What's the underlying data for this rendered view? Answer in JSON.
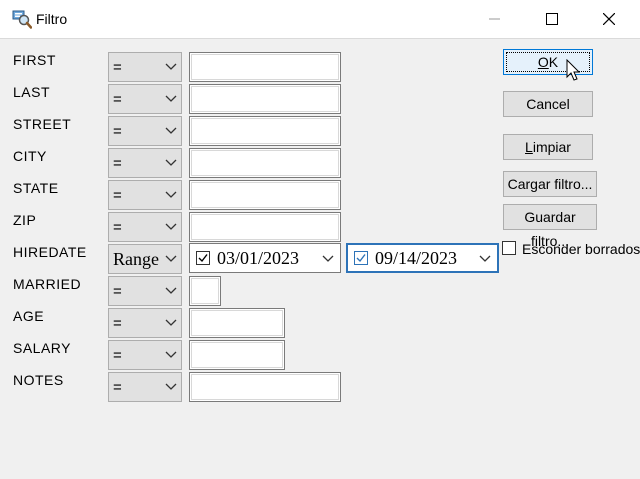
{
  "window": {
    "title": "Filtro",
    "icon": "filter-search-icon",
    "controls": [
      "minimize-icon",
      "maximize-icon",
      "close-icon"
    ]
  },
  "fields": [
    {
      "label": "FIRST",
      "operator": "=",
      "value": ""
    },
    {
      "label": "LAST",
      "operator": "=",
      "value": ""
    },
    {
      "label": "STREET",
      "operator": "=",
      "value": ""
    },
    {
      "label": "CITY",
      "operator": "=",
      "value": ""
    },
    {
      "label": "STATE",
      "operator": "=",
      "value": ""
    },
    {
      "label": "ZIP",
      "operator": "=",
      "value": ""
    },
    {
      "label": "HIREDATE",
      "operator": "Range",
      "from": "03/01/2023",
      "to": "09/14/2023",
      "from_checked": true,
      "to_checked": true
    },
    {
      "label": "MARRIED",
      "operator": "=",
      "value": ""
    },
    {
      "label": "AGE",
      "operator": "=",
      "value": ""
    },
    {
      "label": "SALARY",
      "operator": "=",
      "value": ""
    },
    {
      "label": "NOTES",
      "operator": "=",
      "value": ""
    }
  ],
  "buttons": {
    "ok_hot": "O",
    "ok_rest": "K",
    "cancel": "Cancel",
    "clear_hot": "L",
    "clear_rest": "impiar",
    "load": "Cargar filtro...",
    "save": "Guardar filtro..."
  },
  "hide_deleted": {
    "label": "Esconder borrados",
    "checked": false
  },
  "colors": {
    "accent": "#0078d7",
    "focus_border": "#2d73b8",
    "dialog_bg": "#f0f0f0"
  }
}
